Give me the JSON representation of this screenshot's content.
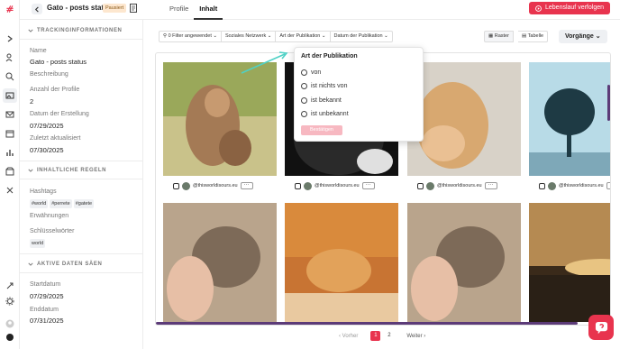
{
  "brand": {
    "logo_glyph": "⁄⁄",
    "accent": "#e8344e",
    "scroll_color": "#5c3b78"
  },
  "rail": {
    "items": [
      {
        "name": "expand-icon",
        "glyph": "›"
      },
      {
        "name": "users-icon"
      },
      {
        "name": "search-icon"
      },
      {
        "name": "images-icon",
        "active": true
      },
      {
        "name": "mail-icon"
      },
      {
        "name": "calendar-icon"
      },
      {
        "name": "stats-icon"
      },
      {
        "name": "box-icon"
      },
      {
        "name": "tools-icon"
      },
      {
        "name": "rocket-icon"
      },
      {
        "name": "settings-icon"
      },
      {
        "name": "user-avatar-icon"
      },
      {
        "name": "theme-icon"
      }
    ]
  },
  "header": {
    "title": "Gato - posts stat...",
    "badge": "Pausiert",
    "tabs": [
      "Profile",
      "Inhalt"
    ],
    "active_tab": "Inhalt",
    "track_button": "Lebenslauf verfolgen"
  },
  "left_panel": {
    "tracking_heading": "TRACKINGINFORMATIONEN",
    "name_label": "Name",
    "name_value": "Gato - posts status",
    "desc_label": "Beschreibung",
    "profiles_label": "Anzahl der Profile",
    "profiles_value": "2",
    "created_label": "Datum der Erstellung",
    "created_value": "07/29/2025",
    "updated_label": "Zuletzt aktualisiert",
    "updated_value": "07/30/2025",
    "rules_heading": "INHALTLICHE REGELN",
    "hashtags_label": "Hashtags",
    "hashtags": [
      "#world",
      "#perrete",
      "#gatete"
    ],
    "mentions_label": "Erwähnungen",
    "keywords_label": "Schlüsselwörter",
    "keywords": [
      "world"
    ],
    "active_heading": "AKTIVE DATEN SÄEN",
    "start_label": "Startdatum",
    "start_value": "07/29/2025",
    "end_label": "Enddatum",
    "end_value": "07/31/2025"
  },
  "filters": {
    "applied": "0 Filter angewendet",
    "network": "Soziales Netzwerk",
    "type": "Art der Publikation",
    "date": "Datum der Publikation",
    "view_grid": "Raster",
    "view_table": "Tabelle",
    "actions": "Vorgänge"
  },
  "popover": {
    "title": "Art der Publikation",
    "options": [
      "von",
      "ist nichts von",
      "ist bekannt",
      "ist unbekannt"
    ],
    "confirm": "Bestätigen"
  },
  "cards": [
    {
      "handle": "@thisworldisours.eu",
      "more": "···"
    },
    {
      "handle": "@thisworldisours.eu",
      "more": "···"
    },
    {
      "handle": "@thisworldisours.eu",
      "more": "···"
    },
    {
      "handle": "@thisworldisours.eu",
      "more": "···"
    }
  ],
  "pagination": {
    "prev": "Vorher",
    "next": "Weiter",
    "pages": [
      "1",
      "2"
    ],
    "current": "1"
  }
}
